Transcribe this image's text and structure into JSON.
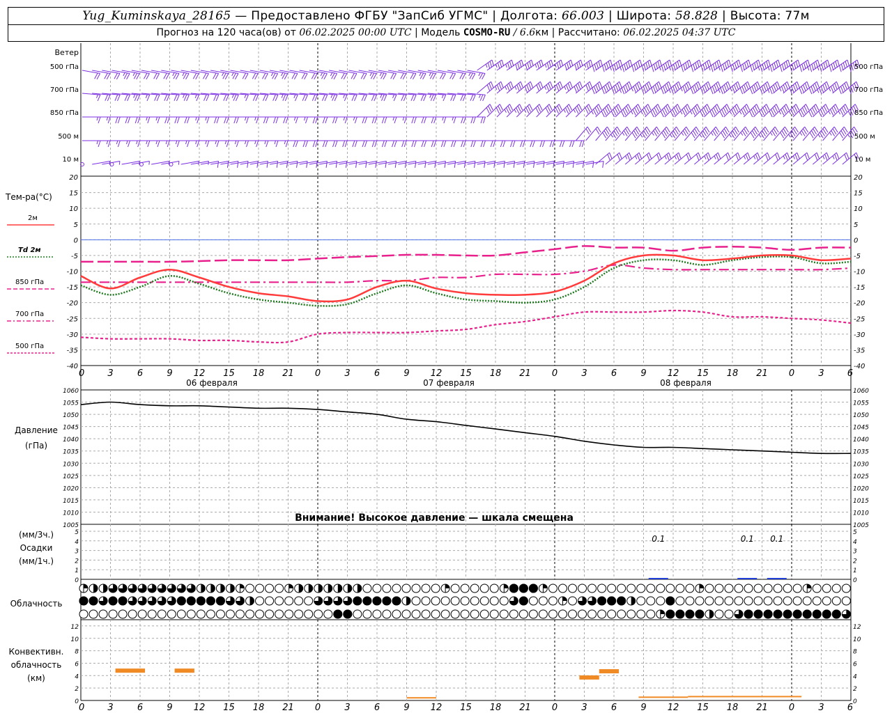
{
  "header": {
    "station": "Yug_Kuminskaya_28165",
    "provided_by": " — Предоставлено ФГБУ \"ЗапСиб УГМС\" | Долгота: ",
    "lon": "66.003",
    "lat_label": " | Широта: ",
    "lat": "58.828",
    "alt_label": " | Высота: 77м",
    "forecast_label": "Прогноз на 120 часа(ов) от ",
    "forecast_start": "06.02.2025 00:00 UTC",
    "model_label": "  | Модель ",
    "model": "COSMO-RU",
    "model_res": " / 6.6",
    "model_res_unit": "км",
    "calc_label": " | Рассчитано: ",
    "calc_time": "06.02.2025 04:37 UTC"
  },
  "labels": {
    "wind": "Ветер",
    "wind_levels": [
      "500 гПа",
      "700 гПа",
      "850 гПа",
      "500 м",
      "10 м"
    ],
    "temp": "Тем-ра(°C)",
    "legend": [
      "2м",
      "Td 2м",
      "850 гПа",
      "700 гПа",
      "500 гПа"
    ],
    "pressure_1": "Давление",
    "pressure_2": "(гПа)",
    "pressure_warning": "Внимание! Высокое давление — шкала смещена",
    "precip_1": "(мм/3ч.)",
    "precip_2": "Осадки",
    "precip_3": "(мм/1ч.)",
    "cloud": "Облачность",
    "conv_1": "Конвективн.",
    "conv_2": "облачность",
    "conv_3": "(км)",
    "days": [
      "06 февраля",
      "07 февраля",
      "08 февраля"
    ]
  },
  "colors": {
    "t2m": "#ff3b3b",
    "td2m": "#1f7a1f",
    "t850": "#e8208c",
    "t700": "#e8208c",
    "t500": "#e8208c",
    "wind": "#7a2ee0",
    "precip": "#1f3fd6",
    "convective": "#f08a24",
    "zero_line": "#4a6ee8"
  },
  "chart_data": [
    {
      "type": "wind_barbs",
      "levels": [
        "500 гПа",
        "700 гПа",
        "850 гПа",
        "500 м",
        "10 м"
      ]
    },
    {
      "type": "line",
      "name": "temperature",
      "x_hours": [
        0,
        3,
        6,
        9,
        12,
        15,
        18,
        21,
        24,
        27,
        30,
        33,
        36,
        39,
        42,
        45,
        48,
        51,
        54,
        57,
        60,
        63,
        66,
        69,
        72,
        75,
        78
      ],
      "x_tick_labels": [
        "0",
        "3",
        "6",
        "9",
        "12",
        "15",
        "18",
        "21",
        "0",
        "3",
        "6",
        "9",
        "12",
        "15",
        "18",
        "21",
        "0",
        "3",
        "6",
        "9",
        "12",
        "15",
        "18",
        "21",
        "0",
        "3",
        "6"
      ],
      "ylim": [
        -40,
        20
      ],
      "y_ticks": [
        20,
        15,
        10,
        5,
        0,
        -5,
        -10,
        -15,
        -20,
        -25,
        -30,
        -35,
        -40
      ],
      "series": [
        {
          "name": "2м",
          "style": "solid",
          "values": [
            -11.5,
            -15.5,
            -12,
            -9.5,
            -12,
            -15,
            -17,
            -18,
            -19.5,
            -19,
            -15,
            -13,
            -15.5,
            -17,
            -17.5,
            -17.5,
            -16.5,
            -13,
            -7.5,
            -5,
            -5,
            -6.5,
            -6,
            -5,
            -5,
            -6.5,
            -6
          ]
        },
        {
          "name": "Td 2м",
          "style": "dotted",
          "values": [
            -14.5,
            -17.5,
            -15,
            -11.5,
            -14,
            -17,
            -19,
            -20,
            -21,
            -20.5,
            -17,
            -14.5,
            -17,
            -19,
            -19.5,
            -20,
            -19,
            -15,
            -9,
            -6.5,
            -6.5,
            -8,
            -6.5,
            -5.5,
            -5.5,
            -7.5,
            -7
          ]
        },
        {
          "name": "850 гПа",
          "style": "longdash",
          "values": [
            -7,
            -7,
            -7,
            -7,
            -6.8,
            -6.5,
            -6.5,
            -6.5,
            -6,
            -5.5,
            -5.2,
            -4.8,
            -4.8,
            -5,
            -5,
            -4,
            -3,
            -2,
            -2.5,
            -2.5,
            -3.5,
            -2.5,
            -2.2,
            -2.5,
            -3.2,
            -2.5,
            -2.5
          ]
        },
        {
          "name": "700 гПа",
          "style": "dashdot",
          "values": [
            -13.5,
            -13.5,
            -13.5,
            -13.5,
            -13.5,
            -13.5,
            -13.5,
            -13.5,
            -13.5,
            -13.5,
            -13,
            -13,
            -12,
            -12,
            -11,
            -11,
            -11,
            -10,
            -8,
            -9,
            -9.5,
            -9.5,
            -9.5,
            -9.5,
            -9.5,
            -9.5,
            -9
          ]
        },
        {
          "name": "500 гПа",
          "style": "shortdash",
          "values": [
            -31,
            -31.5,
            -31.5,
            -31.5,
            -32,
            -32,
            -32.5,
            -32.5,
            -30,
            -29.5,
            -29.5,
            -29.5,
            -29,
            -28.5,
            -27,
            -26,
            -24.5,
            -23,
            -23,
            -23,
            -22.5,
            -23,
            -24.5,
            -24.5,
            -25,
            -25.5,
            -26.5
          ]
        }
      ]
    },
    {
      "type": "line",
      "name": "pressure",
      "ylim": [
        1005,
        1060
      ],
      "y_ticks": [
        1060,
        1055,
        1050,
        1045,
        1040,
        1035,
        1030,
        1025,
        1020,
        1015,
        1010,
        1005
      ],
      "series": [
        {
          "name": "Давление",
          "values": [
            1054,
            1055,
            1054,
            1053.5,
            1053.5,
            1053,
            1052.5,
            1052.5,
            1052,
            1051,
            1050,
            1048,
            1047,
            1045.5,
            1044,
            1042.5,
            1041,
            1039,
            1037.5,
            1036.5,
            1036.5,
            1036,
            1035.5,
            1035,
            1034.5,
            1034,
            1034
          ]
        }
      ]
    },
    {
      "type": "bar",
      "name": "precipitation",
      "ylim": [
        0,
        5
      ],
      "y_ticks": [
        5,
        4,
        3,
        2,
        1,
        0
      ],
      "annotations": [
        {
          "x": 58.5,
          "text": "0.1"
        },
        {
          "x": 67.5,
          "text": "0.1"
        },
        {
          "x": 70.5,
          "text": "0.1"
        }
      ]
    },
    {
      "type": "table",
      "name": "cloudiness",
      "rows": [
        "upper",
        "middle",
        "lower"
      ]
    },
    {
      "type": "bar",
      "name": "convective",
      "ylim": [
        0,
        13
      ],
      "y_ticks": [
        12,
        10,
        8,
        6,
        4,
        2,
        0
      ]
    }
  ]
}
